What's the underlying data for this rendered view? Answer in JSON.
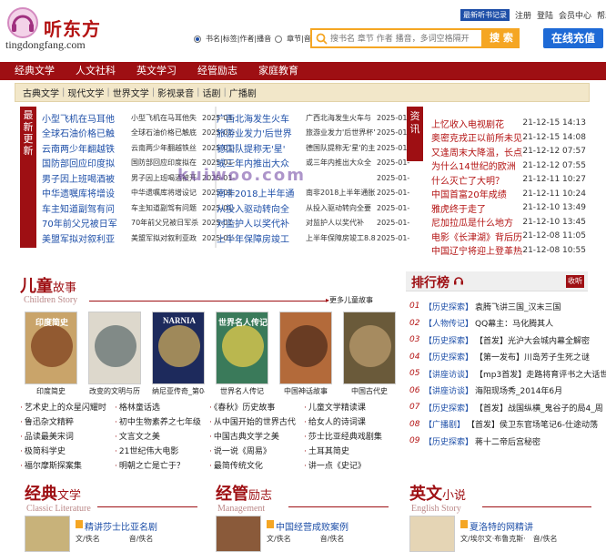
{
  "header": {
    "logo_cn": "听东方",
    "logo_url": "tingdongfang.com",
    "search_scopes": [
      "书名|标签|作者|播音",
      "章节|音频"
    ],
    "search_placeholder": "搜书名 章节 作者 播音，多词空格隔开",
    "search_button": "搜 索",
    "recharge_button": "在线充值",
    "top_links": [
      "最新听书记录",
      "注册",
      "登陆",
      "会员中心",
      "帮助"
    ]
  },
  "main_nav": [
    "经典文学",
    "人文社科",
    "英文学习",
    "经管励志",
    "家庭教育"
  ],
  "sub_nav": [
    "古典文学",
    "现代文学",
    "世界文学",
    "影视录音",
    "话剧",
    "广播剧"
  ],
  "latest": {
    "tab_label": "最新更新",
    "left": [
      {
        "title": "小型飞机在马耳他",
        "sub": "小型飞机在马耳他失",
        "date": "2025-01-"
      },
      {
        "title": "全球石油价格已触",
        "sub": "全球石油价格已触底",
        "date": "2025-01-"
      },
      {
        "title": "云南两少年翻越铁",
        "sub": "云南两少年翻越铁丝",
        "date": "2025-01-"
      },
      {
        "title": "国防部回应印度拟",
        "sub": "国防部回应印度拟在",
        "date": "2025-01-"
      },
      {
        "title": "男子因上班喝酒被",
        "sub": "男子因上班喝酒被开",
        "date": "2025-01-"
      },
      {
        "title": "中华遗嘱库将增设",
        "sub": "中华遗嘱库将增设记",
        "date": "2025-01-"
      },
      {
        "title": "车主知道副驾有问",
        "sub": "车主知道副驾有问题",
        "date": "2025-01-"
      },
      {
        "title": "70年前父兄被日军",
        "sub": "70年前父兄被日军杀",
        "date": "2025-01-"
      },
      {
        "title": "美盟军拟对叙利亚",
        "sub": "美盟军拟对叙利亚政",
        "date": "2025-01-"
      }
    ],
    "right": [
      {
        "title": "广西北海发生火车",
        "sub": "广西北海发生火车与",
        "date": "2025-01-"
      },
      {
        "title": "旅游业发力'后世界",
        "sub": "旅游业发力'后世界杯'",
        "date": "2025-01-"
      },
      {
        "title": "德国队提称无'星'",
        "sub": "德国队提称无'星'的主",
        "date": "2025-01-"
      },
      {
        "title": "或三年内推出大众",
        "sub": "或三年内推出大众全",
        "date": "2025-01-"
      },
      {
        "title": "",
        "sub": "",
        "date": "2025-01-"
      },
      {
        "title": "南非2018上半年通",
        "sub": "南非2018上半年通胀",
        "date": "2025-01-"
      },
      {
        "title": "从投入驱动转向全",
        "sub": "从投入驱动转向全要",
        "date": "2025-01-"
      },
      {
        "title": "对监护人以奖代补",
        "sub": "对监护人以奖代补",
        "date": "2025-01-"
      },
      {
        "title": "上半年保障房竣工",
        "sub": "上半年保障房竣工8.8",
        "date": "2025-01-"
      }
    ]
  },
  "watermark": "kuiwoo.com",
  "info": {
    "tab_label": "资讯",
    "items": [
      {
        "title": "上忆收入电视剧花",
        "date": "21-12-15 14:13"
      },
      {
        "title": "奥密克戎正以前所未见",
        "date": "21-12-15 14:08"
      },
      {
        "title": "又逢周末大降温，长点",
        "date": "21-12-12 07:57"
      },
      {
        "title": "为什么14世纪的欧洲",
        "date": "21-12-12 07:55"
      },
      {
        "title": "什么灭亡了大明？",
        "date": "21-12-11 10:27"
      },
      {
        "title": "中国首富20年成绩",
        "date": "21-12-11 10:24"
      },
      {
        "title": "雅虎终于走了",
        "date": "21-12-10 13:49"
      },
      {
        "title": "尼加拉瓜是什么地方",
        "date": "21-12-10 13:45"
      },
      {
        "title": "电影《长津湖》背后历",
        "date": "21-12-08 11:05"
      },
      {
        "title": "中国辽宁将迎上登革热疫情",
        "date": "21-12-08 10:55"
      }
    ]
  },
  "children": {
    "title_big": "儿童",
    "title_small": "故事",
    "title_en": "Children Story",
    "more": "更多儿童故事",
    "books": [
      {
        "caption": "印度简史",
        "cover_text": "印度简史"
      },
      {
        "caption": "改变的文明与历",
        "cover_text": ""
      },
      {
        "caption": "纳尼亚传奇_第04部",
        "cover_text": "NARNIA"
      },
      {
        "caption": "世界名人传记",
        "cover_text": "世界名人传记"
      },
      {
        "caption": "中国神话故事",
        "cover_text": ""
      },
      {
        "caption": "中国古代史",
        "cover_text": ""
      }
    ],
    "links": [
      [
        "艺术史上的众星闪耀时",
        "格林童话选",
        "《春秋》历史故事",
        "儿童文学精读课"
      ],
      [
        "鲁迅杂文精粹",
        "初中生物素养之七年级",
        "从中国开始的世界古代",
        "给女人的诗词课"
      ],
      [
        "品读最美宋词",
        "文言文之美",
        "中国古典文学之美",
        "莎士比亚经典戏剧集"
      ],
      [
        "极简科学史",
        "21世纪伟大电影",
        "说一说《周易》",
        "土耳其简史"
      ],
      [
        "福尔摩斯探案集",
        "明朝之亡是亡于？",
        "最简传统文化",
        "讲一点《史记》"
      ]
    ]
  },
  "ranking": {
    "title": "排行榜",
    "tab": "收听",
    "items": [
      {
        "num": "01",
        "cat": "【历史探索】",
        "title": "袁腾飞讲三国_汉末三国"
      },
      {
        "num": "02",
        "cat": "【人物传记】",
        "title": "QQ幕主：马化腾其人"
      },
      {
        "num": "03",
        "cat": "【历史探索】",
        "title": "【首发】光沪大会城内幕全解密"
      },
      {
        "num": "04",
        "cat": "【历史探索】",
        "title": "【第一发布】川岛芳子生死之谜"
      },
      {
        "num": "05",
        "cat": "【讲座访谈】",
        "title": "【mp3首发】走路将育评书之大话世"
      },
      {
        "num": "06",
        "cat": "【讲座访谈】",
        "title": "海阳现场秀_2014年6月"
      },
      {
        "num": "07",
        "cat": "【历史探索】",
        "title": "【首发】战国纵横_鬼谷子的局4_周"
      },
      {
        "num": "08",
        "cat": "【广播剧】",
        "title": "【首发】侯卫东官场笔记6-仕途动荡"
      },
      {
        "num": "09",
        "cat": "【历史探索】",
        "title": "蒋十二帝后宫秘密"
      }
    ]
  },
  "bottom": [
    {
      "big": "经典",
      "small": "文学",
      "en": "Classic Literature",
      "item_title": "精讲莎士比亚名剧",
      "meta": "文/佚名　　　　音/佚名"
    },
    {
      "big": "经管",
      "small": "励志",
      "en": "Management",
      "item_title": "中国经营成败案例",
      "meta": "文/佚名　　　　音/佚名"
    },
    {
      "big": "英文",
      "small": "小说",
      "en": "English Story",
      "item_title": "夏洛特的网精讲",
      "meta": "文/埃尔文·布鲁克斯·　音/佚名"
    }
  ],
  "colors": {
    "brand_red": "#9e0f13",
    "accent_orange": "#f5a623",
    "link_blue": "#1e4fa8"
  }
}
